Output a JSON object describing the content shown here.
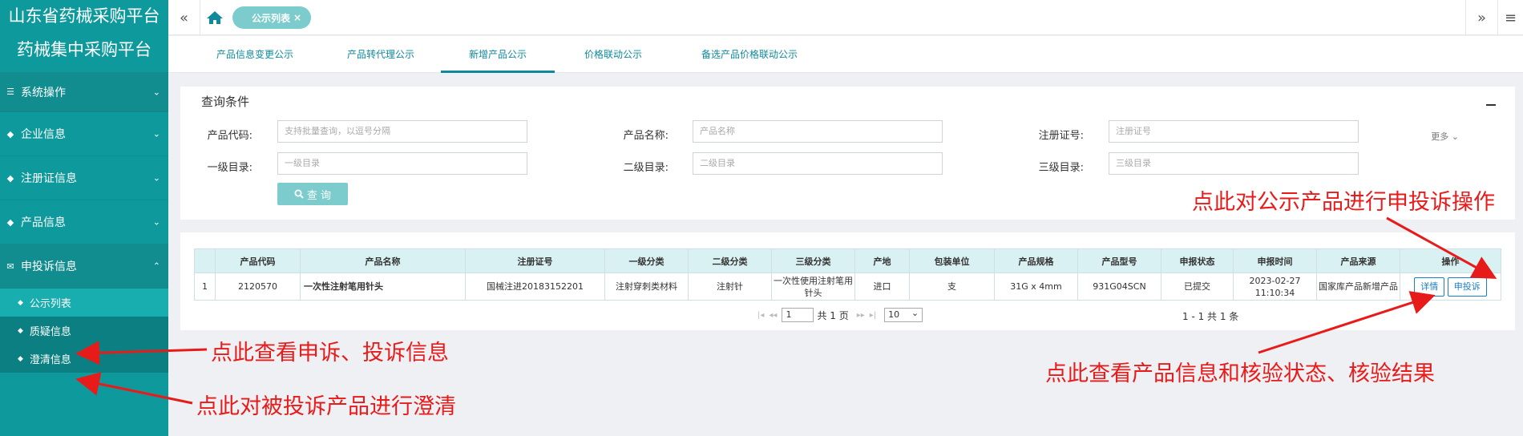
{
  "sidebar": {
    "brand_line1": "山东省药械采购平台",
    "brand_line2": "药械集中采购平台",
    "menu": [
      {
        "label": "系统操作",
        "icon": "list-icon"
      },
      {
        "label": "企业信息",
        "icon": "diamond-icon"
      },
      {
        "label": "注册证信息",
        "icon": "diamond-icon"
      },
      {
        "label": "产品信息",
        "icon": "diamond-icon"
      },
      {
        "label": "申投诉信息",
        "icon": "mail-icon"
      }
    ],
    "submenu": [
      {
        "label": "公示列表"
      },
      {
        "label": "质疑信息"
      },
      {
        "label": "澄清信息"
      }
    ]
  },
  "topbar": {
    "active_tab": "公示列表",
    "collapse_icon": "double-chevron-left-icon",
    "forward_icon": "double-chevron-right-icon",
    "menu_icon": "hamburger-icon"
  },
  "subtabs": [
    "产品信息变更公示",
    "产品转代理公示",
    "新增产品公示",
    "价格联动公示",
    "备选产品价格联动公示"
  ],
  "query": {
    "title": "查询条件",
    "more": "更多",
    "fields": [
      {
        "label": "产品代码:",
        "placeholder": "支持批量查询，以逗号分隔"
      },
      {
        "label": "产品名称:",
        "placeholder": "产品名称"
      },
      {
        "label": "注册证号:",
        "placeholder": "注册证号"
      },
      {
        "label": "一级目录:",
        "placeholder": "一级目录"
      },
      {
        "label": "二级目录:",
        "placeholder": "二级目录"
      },
      {
        "label": "三级目录:",
        "placeholder": "三级目录"
      }
    ],
    "search_button": "查 询"
  },
  "table": {
    "headers": [
      "",
      "产品代码",
      "产品名称",
      "注册证号",
      "一级分类",
      "二级分类",
      "三级分类",
      "产地",
      "包装单位",
      "产品规格",
      "产品型号",
      "申报状态",
      "申报时间",
      "产品来源",
      "操作"
    ],
    "row": {
      "index": "1",
      "code": "2120570",
      "name": "一次性注射笔用针头",
      "reg_no": "国械注进20183152201",
      "cat1": "注射穿刺类材料",
      "cat2": "注射针",
      "cat3": "一次性使用注射笔用针头",
      "origin": "进口",
      "unit": "支",
      "spec": "31G x 4mm",
      "model": "931G04SCN",
      "status": "已提交",
      "time": "2023-02-27 11:10:34",
      "source": "国家库产品新增产品",
      "btn_detail": "详情",
      "btn_complain": "申投诉"
    }
  },
  "pager": {
    "page": "1",
    "total_pages": "共 1 页",
    "page_size": "10",
    "summary": "1 - 1   共 1 条"
  },
  "annotations": {
    "a1": "点此对公示产品进行申投诉操作",
    "a2": "点此查看申诉、投诉信息",
    "a3": "点此对被投诉产品进行澄清",
    "a4": "点此查看产品信息和核验状态、核验结果"
  },
  "colors": {
    "sidebar": "#0e9a9c",
    "accent": "#7ccccd",
    "annotation": "#e81b1b"
  }
}
